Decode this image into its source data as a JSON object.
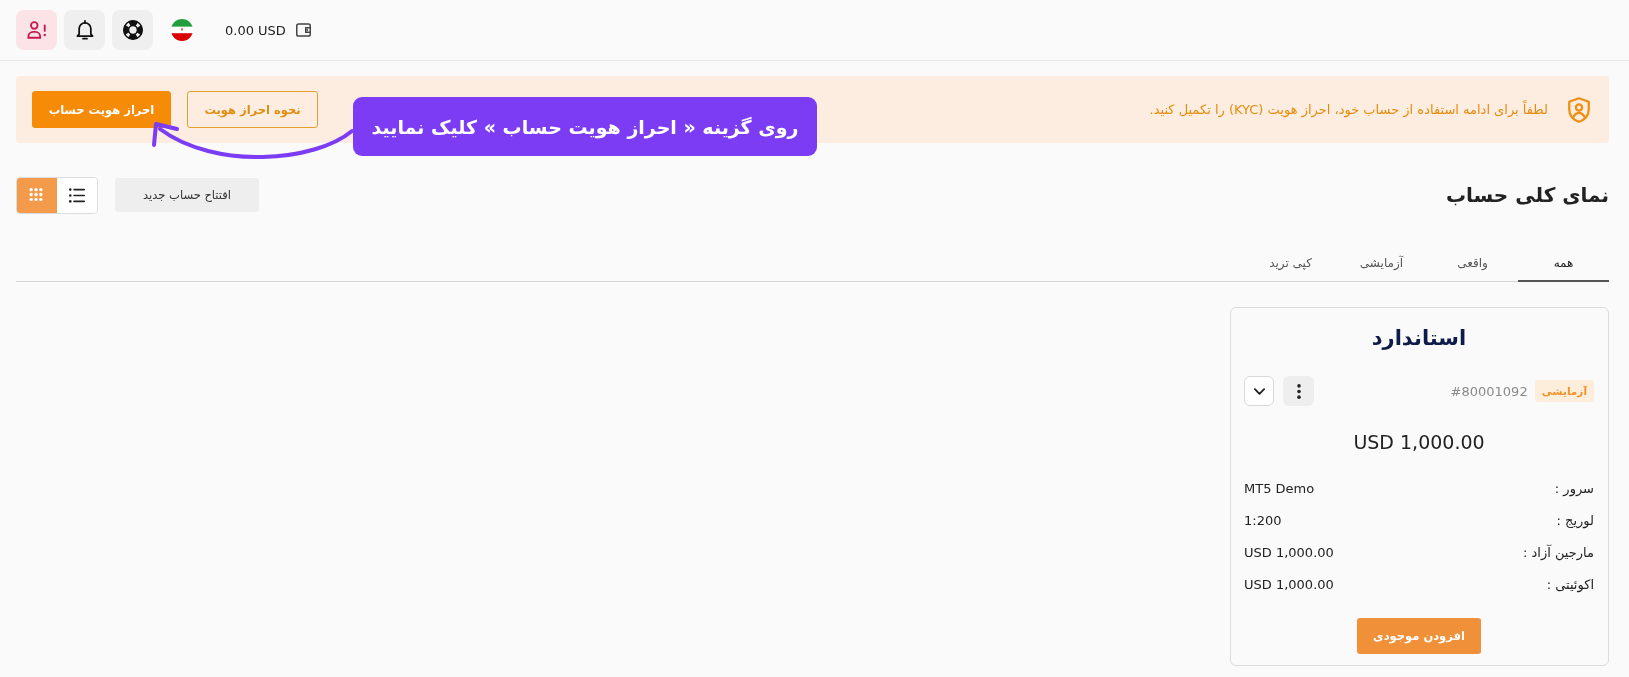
{
  "top_bar": {
    "icon_buttons": [
      {
        "kind": "profile-alert"
      },
      {
        "kind": "notifications"
      },
      {
        "kind": "support"
      }
    ],
    "balance": "0.00 USD"
  },
  "kyc_banner": {
    "message": "لطفاً برای ادامه استفاده از حساب خود، احراز هویت (KYC) را تکمیل کنید.",
    "buttons": [
      {
        "label": "نحوه احراز هویت",
        "kind": "outline"
      },
      {
        "label": "احراز هویت حساب",
        "kind": "primary"
      }
    ]
  },
  "annotation": {
    "text": "روی گزینه « احراز هویت حساب » کلیک نمایید"
  },
  "page": {
    "title": "نمای کلی حساب",
    "new_account_button": "افتتاح حساب جدید",
    "view_toggle": [
      {
        "kind": "list",
        "selected": false
      },
      {
        "kind": "grid",
        "selected": true
      }
    ]
  },
  "tabs": [
    {
      "label": "همه",
      "selected": true
    },
    {
      "label": "واقعی",
      "selected": false
    },
    {
      "label": "آزمایشی",
      "selected": false
    },
    {
      "label": "کپی ترید",
      "selected": false
    }
  ],
  "accounts": [
    {
      "type": "استاندارد",
      "badge": "آزمایشی",
      "number": "#80001092",
      "balance": "USD 1,000.00",
      "details": [
        {
          "label": "سرور :",
          "value": "MT5 Demo"
        },
        {
          "label": "لوریج :",
          "value": "1:200"
        },
        {
          "label": "مارجین آزاد :",
          "value": "USD 1,000.00"
        },
        {
          "label": "اکوئیتی :",
          "value": "USD 1,000.00"
        }
      ],
      "button": "افزودن موجودی"
    }
  ]
}
